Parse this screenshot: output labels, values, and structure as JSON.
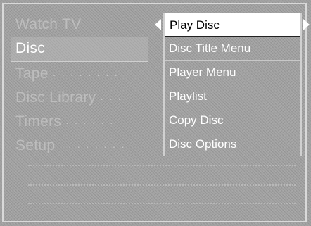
{
  "left_menu": {
    "items": [
      {
        "label": "Watch TV",
        "active": false
      },
      {
        "label": "Disc",
        "active": true
      },
      {
        "label": "Tape",
        "active": false
      },
      {
        "label": "Disc Library",
        "active": false
      },
      {
        "label": "Timers",
        "active": false
      },
      {
        "label": "Setup",
        "active": false
      }
    ]
  },
  "submenu": {
    "items": [
      {
        "label": "Play Disc",
        "highlighted": true
      },
      {
        "label": "Disc Title Menu",
        "highlighted": false
      },
      {
        "label": "Player Menu",
        "highlighted": false
      },
      {
        "label": "Playlist",
        "highlighted": false
      },
      {
        "label": "Copy Disc",
        "highlighted": false
      },
      {
        "label": "Disc Options",
        "highlighted": false
      }
    ]
  },
  "icons": {
    "left_arrow": "triangle-left-icon",
    "right_arrow": "triangle-right-icon"
  },
  "colors": {
    "background": "#a3a3a3",
    "highlight": "#ffffff",
    "active_text": "#ffffff",
    "inactive_text": "#bdbdbd"
  }
}
